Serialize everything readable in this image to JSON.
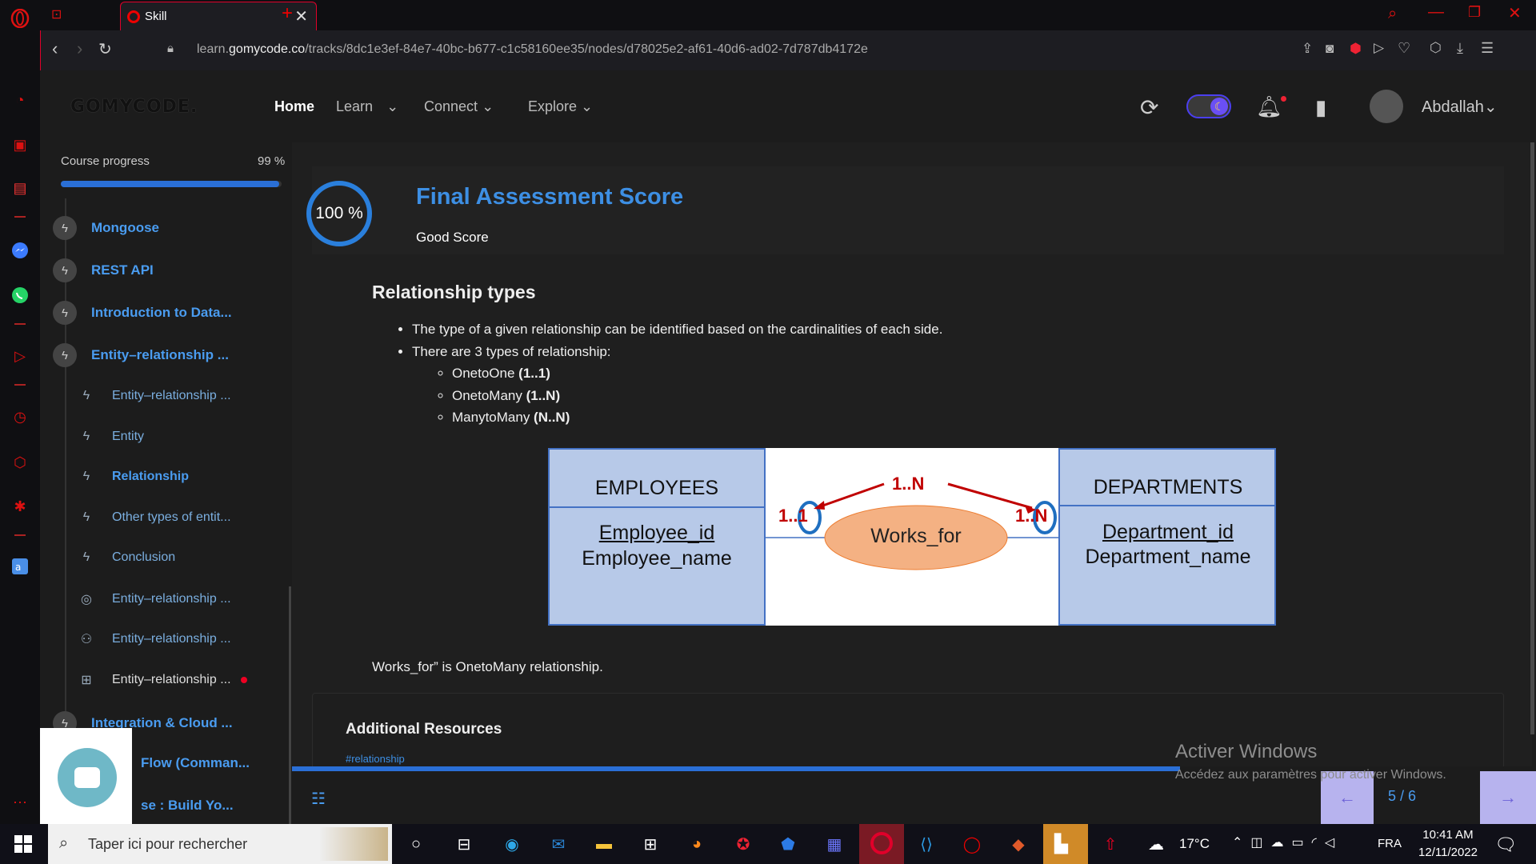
{
  "browser": {
    "tab_title": "Skill",
    "url_prefix": "learn.",
    "url_host": "gomycode.co",
    "url_path": "/tracks/8dc1e3ef-84e7-40bc-b677-c1c58160ee35/nodes/d78025e2-af61-40d6-ad02-7d787db4172e"
  },
  "site": {
    "logo": "GOMYCODE.",
    "nav": {
      "home": "Home",
      "learn": "Learn",
      "connect": "Connect",
      "explore": "Explore"
    },
    "user_name": "Abdallah"
  },
  "course": {
    "progress_label": "Course progress",
    "progress_value": "99 %",
    "progress_fraction": 0.99,
    "modules": [
      {
        "label": "Mongoose"
      },
      {
        "label": "REST API"
      },
      {
        "label": "Introduction to Data..."
      },
      {
        "label": "Entity–relationship ..."
      }
    ],
    "lessons": [
      {
        "label": "Entity–relationship ...",
        "icon": "bolt-icon"
      },
      {
        "label": "Entity",
        "icon": "bolt-icon"
      },
      {
        "label": "Relationship",
        "icon": "bolt-icon"
      },
      {
        "label": "Other types of entit...",
        "icon": "bolt-icon"
      },
      {
        "label": "Conclusion",
        "icon": "bolt-icon"
      },
      {
        "label": "Entity–relationship ...",
        "icon": "target-icon"
      },
      {
        "label": "Entity–relationship ...",
        "icon": "people-icon"
      },
      {
        "label": "Entity–relationship ...",
        "icon": "board-icon"
      }
    ],
    "more_modules": [
      {
        "label": "Integration & Cloud ..."
      },
      {
        "label": "Flow (Comman..."
      },
      {
        "label": "se : Build Yo..."
      }
    ]
  },
  "assessment": {
    "score": "100 %",
    "title": "Final Assessment Score",
    "subtitle": "Good Score"
  },
  "content": {
    "heading": "Relationship types",
    "bullets": [
      "The type of a given relationship can be identified based on the cardinalities of each side.",
      "There are 3 types of relationship:"
    ],
    "subbullets": [
      {
        "name": "OnetoOne ",
        "card": "(1..1)"
      },
      {
        "name": "OnetoMany ",
        "card": "(1..N)"
      },
      {
        "name": "ManytoMany ",
        "card": "(N..N)"
      }
    ],
    "diagram": {
      "left_entity": "EMPLOYEES",
      "left_key": "Employee_id",
      "left_attr": "Employee_name",
      "relationship": "Works_for",
      "right_entity": "DEPARTMENTS",
      "right_key": "Department_id",
      "right_attr": "Department_name",
      "left_card": "1..1",
      "middle_card": "1..N",
      "right_card": "1..N"
    },
    "conclusion": "Works_for” is OnetoMany relationship.",
    "resources_heading": "Additional Resources",
    "tag": "#relationship"
  },
  "pager": {
    "page": "5 / 6"
  },
  "watermark": {
    "title": "Activer Windows",
    "text": "Accédez aux paramètres pour activer Windows."
  },
  "taskbar": {
    "search_placeholder": "Taper ici pour rechercher",
    "temperature": "17°C",
    "language": "FRA",
    "time": "10:41 AM",
    "date": "12/11/2022"
  }
}
